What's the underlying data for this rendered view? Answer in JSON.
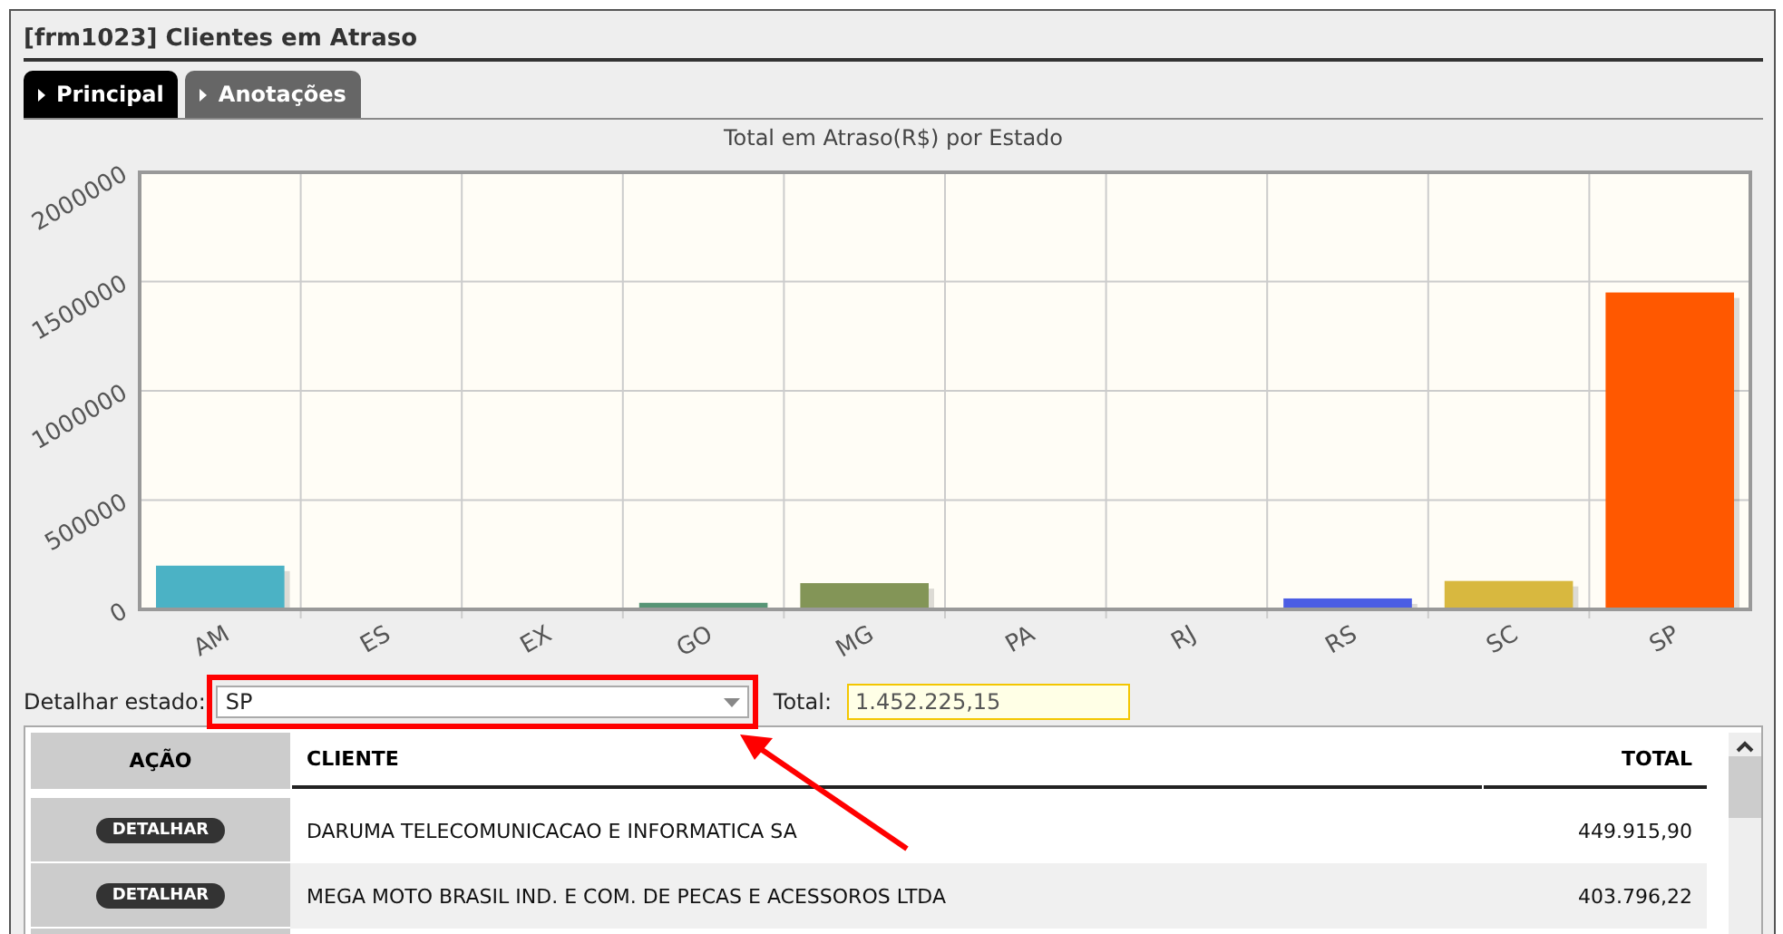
{
  "window": {
    "title": "[frm1023] Clientes em Atraso"
  },
  "tabs": [
    {
      "label": "Principal",
      "selected": true
    },
    {
      "label": "Anotações",
      "selected": false
    }
  ],
  "chart": {
    "bars": [
      {
        "color": "#4bb2c5"
      },
      {
        "color": "#579575"
      },
      {
        "color": "#839557"
      },
      {
        "color": "#4b5de4"
      },
      {
        "color": "#d8b83f"
      },
      {
        "color": "#ff5800"
      }
    ],
    "chart_data": {
      "type": "bar",
      "title": "Total em Atraso(R$) por Estado",
      "categories": [
        "AM",
        "ES",
        "EX",
        "GO",
        "MG",
        "PA",
        "RJ",
        "RS",
        "SC",
        "SP"
      ],
      "values": [
        200000,
        0,
        0,
        30000,
        120000,
        0,
        0,
        50000,
        130000,
        1450000
      ],
      "grid": true,
      "ylim": [
        0,
        2000000
      ],
      "yticks": [
        0,
        500000,
        1000000,
        1500000,
        2000000
      ]
    }
  },
  "filter": {
    "label": "Detalhar estado:",
    "value": "SP",
    "total_label": "Total:",
    "total_value": "1.452.225,15"
  },
  "table": {
    "columns": [
      "AÇÃO",
      "CLIENTE",
      "TOTAL"
    ],
    "rows": [
      {
        "action": "DETALHAR",
        "cliente": "DARUMA TELECOMUNICACAO E INFORMATICA SA",
        "total": "449.915,90"
      },
      {
        "action": "DETALHAR",
        "cliente": "MEGA MOTO BRASIL IND. E COM. DE PECAS E ACESSOROS LTDA",
        "total": "403.796,22"
      }
    ]
  }
}
